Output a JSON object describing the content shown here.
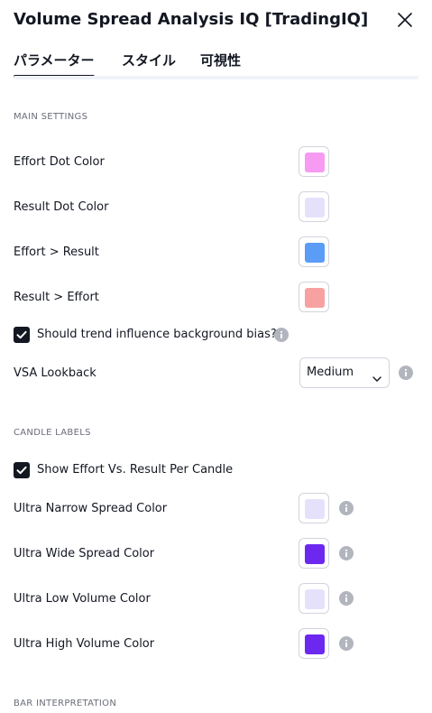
{
  "dialog": {
    "title": "Volume Spread Analysis IQ [TradingIQ]",
    "close_icon": "close-icon"
  },
  "tabs": [
    {
      "label": "パラメーター",
      "active": true
    },
    {
      "label": "スタイル",
      "active": false
    },
    {
      "label": "可視性",
      "active": false
    }
  ],
  "main_settings": {
    "title": "MAIN SETTINGS",
    "effort_dot": {
      "label": "Effort Dot Color",
      "color": "#f79bf2"
    },
    "result_dot": {
      "label": "Result Dot Color",
      "color": "#e6e1fb"
    },
    "effort_gt_result": {
      "label": "Effort > Result",
      "color": "#5b9cf6"
    },
    "result_gt_effort": {
      "label": "Result > Effort",
      "color": "#f7a1a1"
    },
    "trend_bias": {
      "label": "Should trend influence background bias?",
      "checked": true
    },
    "vsa_lookback": {
      "label": "VSA Lookback",
      "value": "Medium"
    }
  },
  "candle_labels": {
    "title": "CANDLE LABELS",
    "show_effort": {
      "label": "Show Effort Vs. Result Per Candle",
      "checked": true
    },
    "ultra_narrow": {
      "label": "Ultra Narrow Spread Color",
      "color": "#e6e1fb"
    },
    "ultra_wide": {
      "label": "Ultra Wide Spread Color",
      "color": "#6d28f0"
    },
    "ultra_low": {
      "label": "Ultra Low Volume Color",
      "color": "#e6e1fb"
    },
    "ultra_high": {
      "label": "Ultra High Volume Color",
      "color": "#6d28f0"
    }
  },
  "bar_interpretation": {
    "title": "BAR INTERPRETATION"
  }
}
